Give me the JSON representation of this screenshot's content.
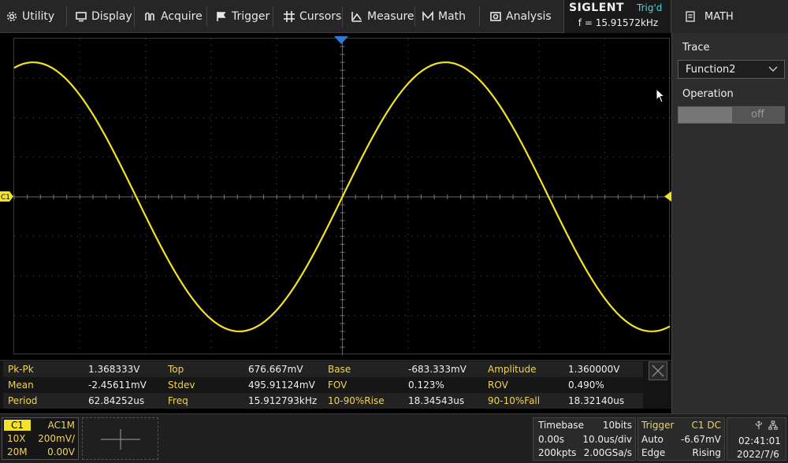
{
  "menu": {
    "items": [
      {
        "label": "Utility",
        "icon": "gear-icon"
      },
      {
        "label": "Display",
        "icon": "monitor-icon"
      },
      {
        "label": "Acquire",
        "icon": "acquire-wave-icon"
      },
      {
        "label": "Trigger",
        "icon": "flag-icon"
      },
      {
        "label": "Cursors",
        "icon": "crosshair-icon"
      },
      {
        "label": "Measure",
        "icon": "measure-icon"
      },
      {
        "label": "Math",
        "icon": "math-m-icon"
      },
      {
        "label": "Analysis",
        "icon": "analysis-icon"
      }
    ]
  },
  "brand": {
    "name": "SIGLENT",
    "trigger_status": "Trig'd",
    "frequency": "f = 15.91572kHz"
  },
  "side_panel": {
    "title": "MATH",
    "trace_label": "Trace",
    "trace_value": "Function2",
    "operation_label": "Operation",
    "operation_value": "off",
    "operation_enabled": false
  },
  "waveform": {
    "channel_marker": "C1",
    "color": "#f4e22a",
    "amplitude_v": 0.68,
    "frequency_khz": 15.91572
  },
  "measurements": [
    [
      {
        "label": "Pk-Pk",
        "value": "1.368333V"
      },
      {
        "label": "Top",
        "value": "676.667mV"
      },
      {
        "label": "Base",
        "value": "-683.333mV"
      },
      {
        "label": "Amplitude",
        "value": "1.360000V"
      }
    ],
    [
      {
        "label": "Mean",
        "value": "-2.45611mV"
      },
      {
        "label": "Stdev",
        "value": "495.91124mV"
      },
      {
        "label": "FOV",
        "value": "0.123%"
      },
      {
        "label": "ROV",
        "value": "0.490%"
      }
    ],
    [
      {
        "label": "Period",
        "value": "62.84252us"
      },
      {
        "label": "Freq",
        "value": "15.912793kHz"
      },
      {
        "label": "10-90%Rise",
        "value": "18.34543us"
      },
      {
        "label": "90-10%Fall",
        "value": "18.32140us"
      }
    ]
  ],
  "status": {
    "channel": {
      "name": "C1",
      "coupling": "AC1M",
      "probe": "10X",
      "scale": "200mV/",
      "bandwidth": "20M",
      "offset": "0.00V"
    },
    "timebase": {
      "title": "Timebase",
      "bits": "10bits",
      "delay": "0.00s",
      "scale": "10.0us/div",
      "memory": "200kpts",
      "sample_rate": "2.00GSa/s"
    },
    "trigger": {
      "title": "Trigger",
      "source": "C1 DC",
      "mode": "Auto",
      "level": "-6.67mV",
      "type": "Edge",
      "slope": "Rising"
    },
    "clock": {
      "time": "02:41:01",
      "date": "2022/7/6"
    }
  },
  "colors": {
    "channel_yellow": "#f4e22a",
    "label_yellow": "#f1d35a",
    "trig_cyan": "#3fd7e8",
    "trigger_marker_blue": "#2e7bd6"
  }
}
